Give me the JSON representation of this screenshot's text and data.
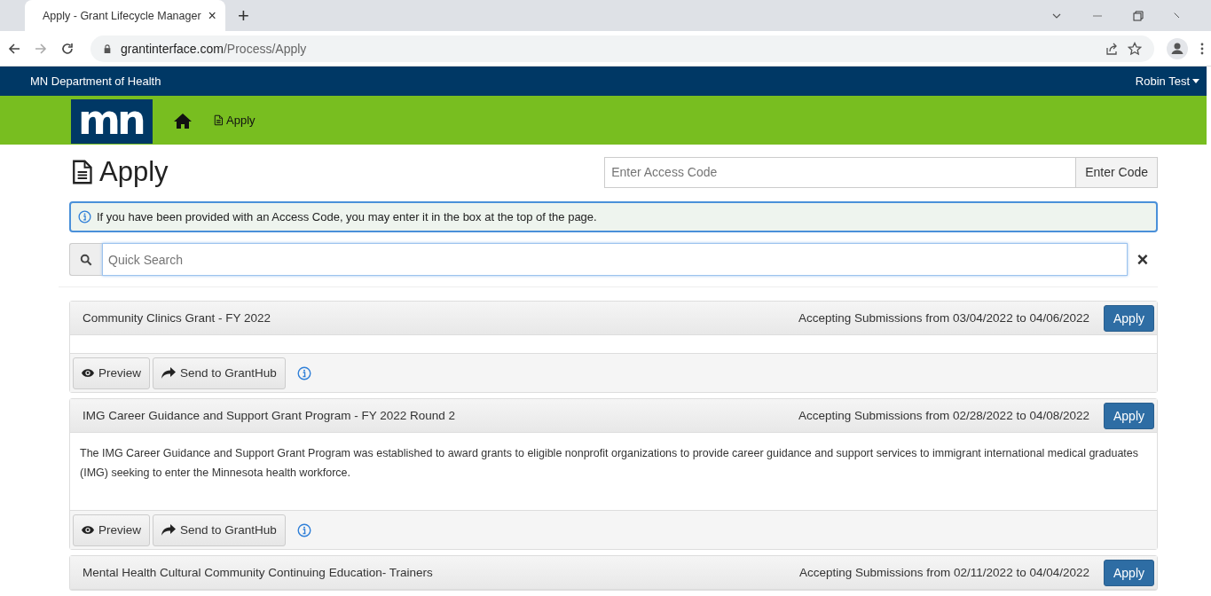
{
  "browser": {
    "tab_title": "Apply - Grant Lifecycle Manager",
    "tab_close": "×",
    "new_tab": "+",
    "url_domain": "grantinterface.com",
    "url_path": "/Process/Apply"
  },
  "top_bar": {
    "organization": "MN Department of Health",
    "user": "Robin Test"
  },
  "nav": {
    "logo_text": "mn",
    "items": [
      {
        "kind": "home"
      },
      {
        "kind": "link",
        "label": "Apply"
      }
    ]
  },
  "page": {
    "title": "Apply",
    "access_code": {
      "placeholder": "Enter Access Code",
      "button": "Enter Code"
    },
    "notice": "If you have been provided with an Access Code, you may enter it in the box at the top of the page.",
    "search": {
      "placeholder": "Quick Search",
      "clear": "×"
    }
  },
  "grants": [
    {
      "name": "Community Clinics Grant - FY 2022",
      "dates": "Accepting Submissions from 03/04/2022 to 04/06/2022",
      "apply": "Apply",
      "preview": "Preview",
      "send": "Send to GrantHub"
    },
    {
      "name": "IMG Career Guidance and Support Grant Program - FY 2022 Round 2",
      "dates": "Accepting Submissions from 02/28/2022 to 04/08/2022",
      "apply": "Apply",
      "description": "The IMG Career Guidance and Support Grant Program was established to award grants to eligible nonprofit organizations to provide career guidance and support services to immigrant international medical graduates (IMG) seeking to enter the Minnesota health workforce.",
      "preview": "Preview",
      "send": "Send to GrantHub"
    },
    {
      "name": "Mental Health Cultural Community Continuing Education- Trainers",
      "dates": "Accepting Submissions from 02/11/2022 to 04/04/2022",
      "apply": "Apply"
    }
  ]
}
